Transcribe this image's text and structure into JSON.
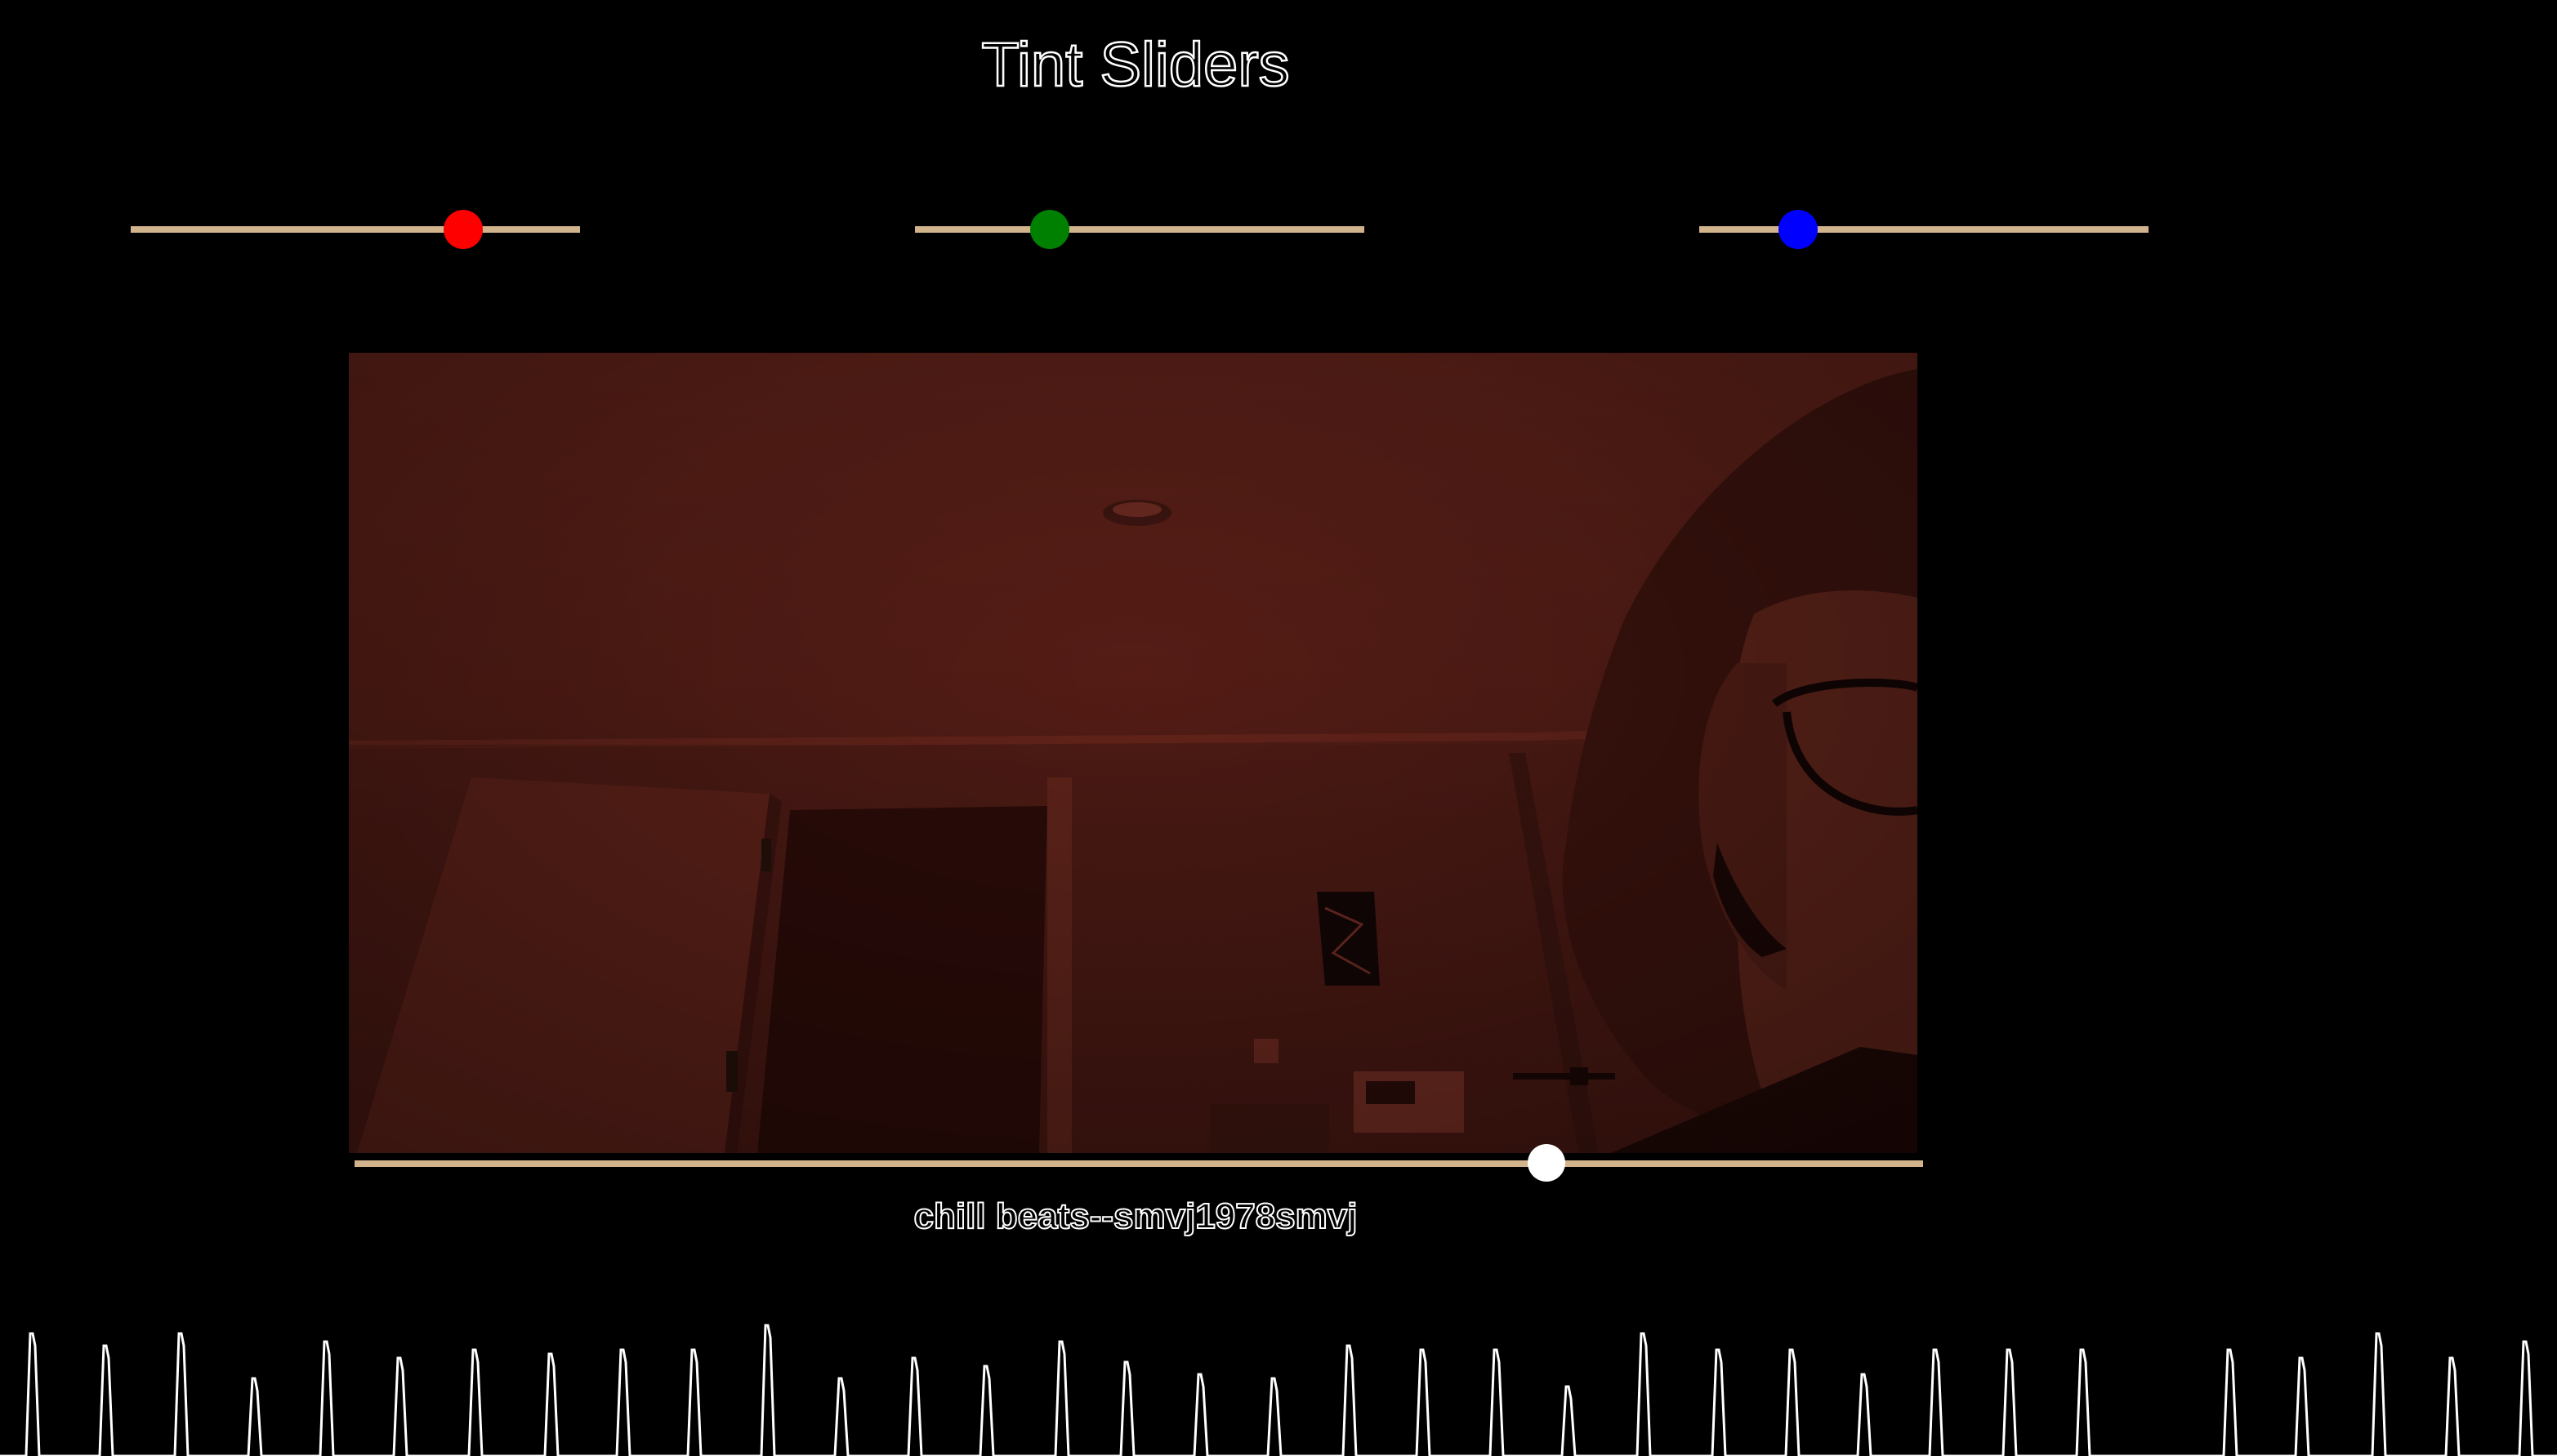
{
  "page": {
    "title": "Tint Sliders"
  },
  "tint_sliders": [
    {
      "channel": "red",
      "color": "#ff0000",
      "value_fraction": 0.74
    },
    {
      "channel": "green",
      "color": "#008000",
      "value_fraction": 0.3
    },
    {
      "channel": "blue",
      "color": "#0000ff",
      "value_fraction": 0.22
    }
  ],
  "video": {
    "tint_color": "#5a1f17"
  },
  "player": {
    "progress_fraction": 0.76,
    "track_title": "chill beats--smvj1978smvj"
  },
  "colors": {
    "background": "#000000",
    "slider_track": "#d2b48c",
    "seek_thumb": "#ffffff"
  },
  "icons": {
    "waveform": "audio-waveform-icon"
  }
}
